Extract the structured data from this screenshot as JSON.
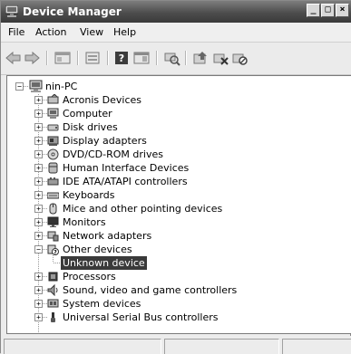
{
  "window": {
    "title": "Device Manager",
    "controls": {
      "minimize": "_",
      "maximize": "□",
      "close": "×"
    }
  },
  "menu": {
    "items": [
      "File",
      "Action",
      "View",
      "Help"
    ]
  },
  "toolbar": {
    "buttons": [
      "back-icon",
      "forward-icon",
      "properties-icon",
      "show-hide-console-tree-icon",
      "help-icon",
      "action-pane-icon",
      "scan-hardware-icon",
      "update-driver-icon",
      "uninstall-icon",
      "disable-icon"
    ]
  },
  "tree": {
    "root": "nin-PC",
    "categories": [
      {
        "label": "Acronis Devices",
        "icon": "acronis-icon",
        "expanded": false
      },
      {
        "label": "Computer",
        "icon": "computer-icon",
        "expanded": false
      },
      {
        "label": "Disk drives",
        "icon": "disk-drive-icon",
        "expanded": false
      },
      {
        "label": "Display adapters",
        "icon": "display-adapter-icon",
        "expanded": false
      },
      {
        "label": "DVD/CD-ROM drives",
        "icon": "dvd-drive-icon",
        "expanded": false
      },
      {
        "label": "Human Interface Devices",
        "icon": "hid-icon",
        "expanded": false
      },
      {
        "label": "IDE ATA/ATAPI controllers",
        "icon": "ide-controller-icon",
        "expanded": false
      },
      {
        "label": "Keyboards",
        "icon": "keyboard-icon",
        "expanded": false
      },
      {
        "label": "Mice and other pointing devices",
        "icon": "mouse-icon",
        "expanded": false
      },
      {
        "label": "Monitors",
        "icon": "monitor-icon",
        "expanded": false
      },
      {
        "label": "Network adapters",
        "icon": "network-adapter-icon",
        "expanded": false
      },
      {
        "label": "Other devices",
        "icon": "other-devices-icon",
        "expanded": true
      },
      {
        "label": "Processors",
        "icon": "processor-icon",
        "expanded": false
      },
      {
        "label": "Sound, video and game controllers",
        "icon": "sound-icon",
        "expanded": false
      },
      {
        "label": "System devices",
        "icon": "system-devices-icon",
        "expanded": false
      },
      {
        "label": "Universal Serial Bus controllers",
        "icon": "usb-icon",
        "expanded": false
      }
    ],
    "other_devices_children": [
      {
        "label": "Unknown device",
        "icon": "unknown-device-icon",
        "selected": true
      }
    ]
  },
  "colors": {
    "titlebar": "#4d4d4d",
    "selection": "#3a3a3a"
  }
}
